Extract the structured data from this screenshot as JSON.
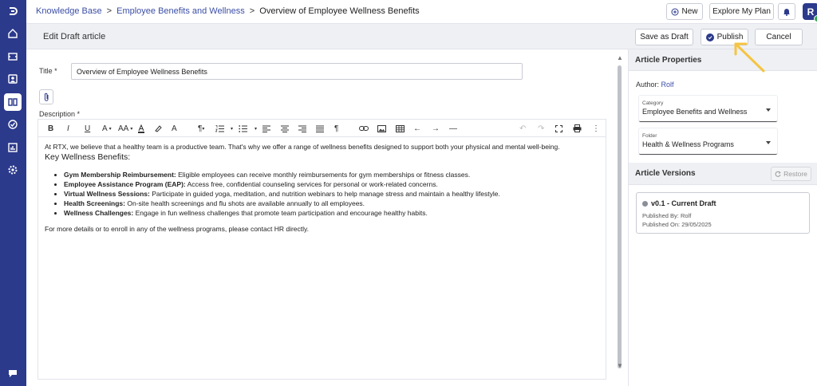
{
  "breadcrumb": {
    "items": [
      "Knowledge Base",
      "Employee Benefits and Wellness"
    ],
    "separator": ">",
    "current": "Overview of Employee Wellness Benefits"
  },
  "topbar": {
    "new_label": "New",
    "explore_label": "Explore My Plan",
    "avatar_initial": "R"
  },
  "header": {
    "title": "Edit Draft article",
    "save_draft_label": "Save as Draft",
    "publish_label": "Publish",
    "cancel_label": "Cancel"
  },
  "form": {
    "title_label": "Title *",
    "title_value": "Overview of Employee Wellness Benefits",
    "description_label": "Description *"
  },
  "content": {
    "intro": "At RTX, we believe that a healthy team is a productive team. That's why we offer a range of wellness benefits designed to support both your physical and mental well-being.",
    "heading": "Key Wellness Benefits:",
    "benefits": [
      {
        "name": "Gym Membership Reimbursement:",
        "text": " Eligible employees can receive monthly reimbursements for gym memberships or fitness classes."
      },
      {
        "name": "Employee Assistance Program (EAP):",
        "text": " Access free, confidential counseling services for personal or work-related concerns."
      },
      {
        "name": "Virtual Wellness Sessions:",
        "text": " Participate in guided yoga, meditation, and nutrition webinars to help manage stress and maintain a healthy lifestyle."
      },
      {
        "name": "Health Screenings:",
        "text": " On-site health screenings and flu shots are available annually to all employees."
      },
      {
        "name": "Wellness Challenges:",
        "text": " Engage in fun wellness challenges that promote team participation and encourage healthy habits."
      }
    ],
    "closing": "For more details or to enroll in any of the wellness programs, please contact HR directly."
  },
  "toolbar": {
    "bold": "B",
    "italic": "I",
    "underline": "U",
    "font_color": "A",
    "font_size": "AA",
    "clear_format": "A"
  },
  "properties": {
    "title": "Article Properties",
    "author_label": "Author:",
    "author_name": "Rolf",
    "category_label": "Category",
    "category_value": "Employee Benefits and Wellness",
    "folder_label": "Folder",
    "folder_value": "Health & Wellness Programs"
  },
  "versions": {
    "title": "Article Versions",
    "restore_label": "Restore",
    "items": [
      {
        "title": "v0.1 -  Current Draft",
        "published_by": "Published By: Rolf",
        "published_on": "Published On: 29/05/2025"
      }
    ]
  },
  "colors": {
    "rail": "#2c3a8c",
    "link": "#3b4ea6",
    "annotation": "#f5c542",
    "online": "#2fa84f"
  }
}
